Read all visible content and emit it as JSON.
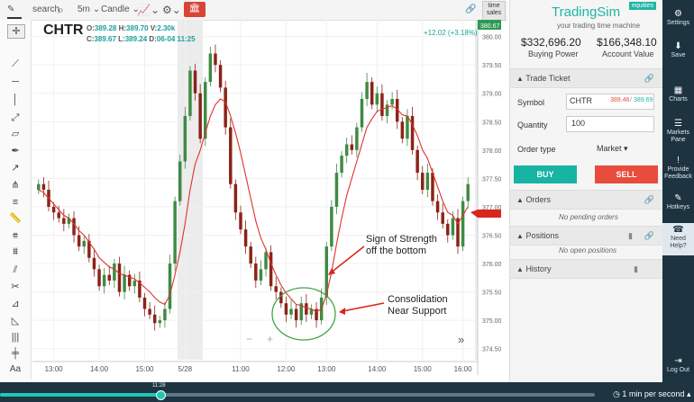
{
  "toolbar": {
    "search": "search",
    "interval": "5m",
    "chart_style": "Candle",
    "time_sales_1": "time",
    "time_sales_2": "sales"
  },
  "chart": {
    "symbol": "CHTR",
    "o_label": "O:",
    "o_val": "389.28",
    "h_label": "H:",
    "h_val": "389.70",
    "v_label": "V:",
    "v_val": "2.30k",
    "c_label": "C:",
    "c_val": "389.67",
    "l_label": "L:",
    "l_val": "389.24",
    "d_label": "D:",
    "d_val": "06-04 11:25",
    "change": "+12.02 (+3.18%)",
    "price_badge": "380.67",
    "y_ticks": [
      "380.00",
      "379.50",
      "379.00",
      "378.50",
      "378.00",
      "377.50",
      "377.00",
      "376.50",
      "376.00",
      "375.50",
      "375.00",
      "374.50"
    ],
    "x_ticks": [
      "13:00",
      "14:00",
      "15:00",
      "5/28",
      "11:00",
      "12:00",
      "13:00",
      "14:00",
      "15:00",
      "16:00"
    ],
    "annotation1_line1": "Sign of Strength",
    "annotation1_line2": "off the bottom",
    "annotation2_line1": "Consolidation",
    "annotation2_line2": "Near Support",
    "zoom_minus": "−",
    "zoom_plus": "+",
    "scroll_right": "»"
  },
  "chart_data": {
    "type": "candlestick",
    "y_range": [
      374.4,
      380.2
    ],
    "close": [
      377.4,
      377.3,
      377.0,
      376.9,
      376.8,
      376.7,
      376.8,
      376.5,
      376.3,
      376.4,
      376.1,
      375.9,
      375.6,
      375.8,
      375.7,
      376.0,
      375.5,
      375.8,
      375.6,
      375.7,
      375.4,
      375.2,
      375.1,
      374.95,
      375.0,
      375.2,
      376.0,
      377.1,
      377.8,
      378.6,
      379.4,
      379.0,
      378.2,
      379.2,
      379.7,
      379.5,
      379.1,
      378.4,
      377.4,
      376.9,
      376.6,
      376.3,
      376.0,
      375.7,
      375.9,
      376.2,
      375.6,
      375.5,
      375.3,
      375.1,
      375.2,
      375.0,
      375.3,
      375.1,
      375.2,
      375.0,
      375.4,
      376.3,
      377.0,
      377.6,
      377.9,
      378.1,
      378.0,
      378.4,
      378.9,
      379.2,
      378.8,
      379.0,
      378.6,
      378.8,
      378.9,
      378.5,
      378.2,
      378.6,
      378.0,
      377.6,
      377.3,
      377.6,
      377.1,
      376.9,
      376.7,
      376.5,
      376.8,
      376.3,
      377.1,
      377.4
    ],
    "ema": [
      377.3,
      377.25,
      377.15,
      377.05,
      376.95,
      376.85,
      376.8,
      376.7,
      376.58,
      376.5,
      376.38,
      376.25,
      376.1,
      376.02,
      375.94,
      375.9,
      375.82,
      375.8,
      375.76,
      375.73,
      375.66,
      375.58,
      375.5,
      375.4,
      375.32,
      375.28,
      375.45,
      375.8,
      376.2,
      376.7,
      377.3,
      377.75,
      378.0,
      378.3,
      378.6,
      378.8,
      378.9,
      378.85,
      378.6,
      378.3,
      377.95,
      377.55,
      377.15,
      376.75,
      376.45,
      376.25,
      376.0,
      375.8,
      375.62,
      375.48,
      375.38,
      375.28,
      375.26,
      375.22,
      375.2,
      375.15,
      375.2,
      375.45,
      375.85,
      376.35,
      376.8,
      377.2,
      377.5,
      377.8,
      378.1,
      378.4,
      378.55,
      378.68,
      378.72,
      378.75,
      378.78,
      378.72,
      378.62,
      378.6,
      378.45,
      378.25,
      378.0,
      377.85,
      377.6,
      377.35,
      377.1,
      376.9,
      376.85,
      376.7,
      376.85,
      377.0
    ],
    "series": [
      {
        "name": "Candles"
      },
      {
        "name": "EMA"
      }
    ]
  },
  "ticket": {
    "brand": "TradingSim",
    "equities": "equities",
    "tagline": "your trading time machine",
    "buying_power": "$332,696.20",
    "buying_power_label": "Buying Power",
    "account_value": "$166,348.10",
    "account_value_label": "Account Value",
    "trade_ticket": "Trade Ticket",
    "symbol_label": "Symbol",
    "symbol_value": "CHTR",
    "bid": "389.46",
    "sep": "/",
    "ask": "389.69",
    "quantity_label": "Quantity",
    "quantity_value": "100",
    "order_type_label": "Order type",
    "order_type_value": "Market",
    "buy": "BUY",
    "sell": "SELL",
    "orders": "Orders",
    "no_orders": "No pending orders",
    "positions": "Positions",
    "no_positions": "No open positions",
    "history": "History"
  },
  "nav": {
    "settings": "Settings",
    "save": "Save",
    "charts": "Charts",
    "markets_1": "Markets",
    "markets_2": "Pane",
    "feedback_1": "Provide",
    "feedback_2": "Feedback",
    "hotkeys": "Hotkeys",
    "help_1": "Need",
    "help_2": "Help?",
    "logout_1": "Log Out"
  },
  "playback": {
    "time_label": "11:28",
    "speed": "1 min per second",
    "progress": 0.27
  },
  "colors": {
    "up": "#3f8a44",
    "down": "#8b2318",
    "ema": "#e0312b",
    "buy": "#17b3a3",
    "sell": "#e74c3c",
    "nav": "#1d3340",
    "teal": "#1fb5a6"
  }
}
